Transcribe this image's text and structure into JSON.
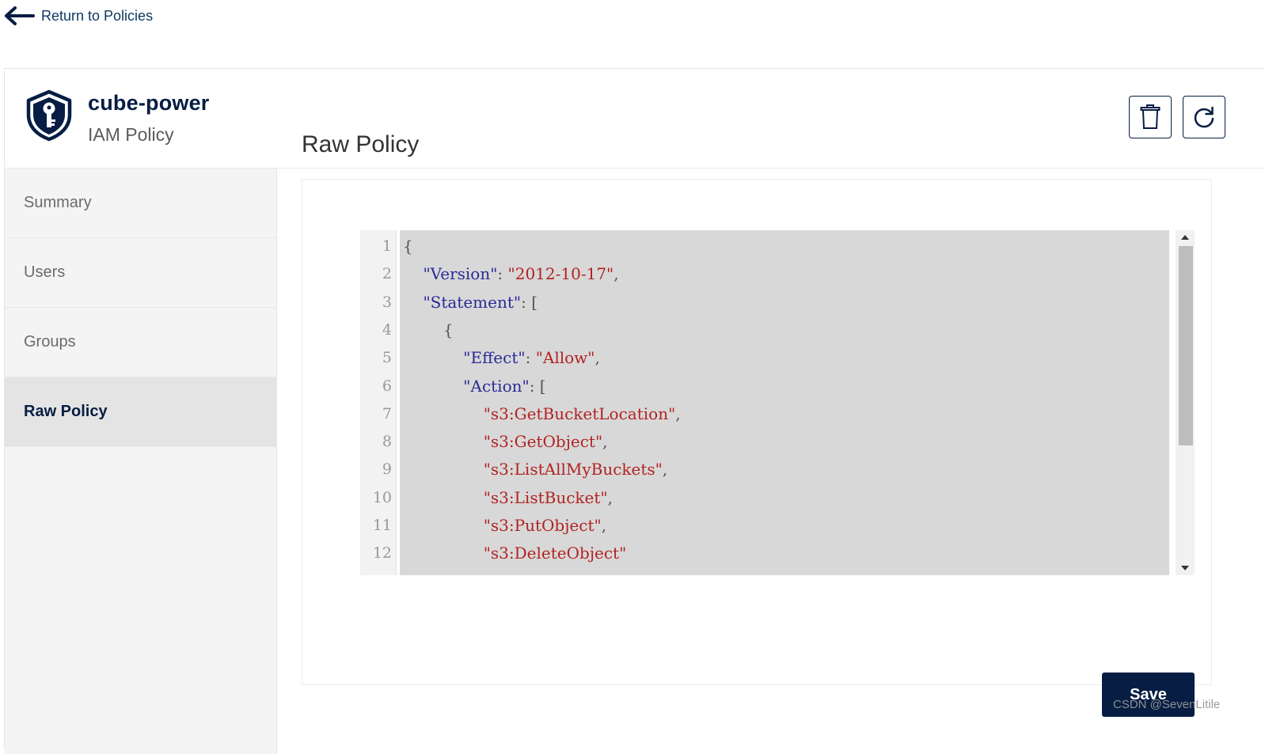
{
  "nav": {
    "back_label": "Return to Policies"
  },
  "policy": {
    "name": "cube-power",
    "type_label": "IAM Policy"
  },
  "sidebar": {
    "items": [
      {
        "label": "Summary",
        "active": false
      },
      {
        "label": "Users",
        "active": false
      },
      {
        "label": "Groups",
        "active": false
      },
      {
        "label": "Raw Policy",
        "active": true
      }
    ]
  },
  "main": {
    "title": "Raw Policy",
    "save_label": "Save"
  },
  "editor": {
    "lines": [
      {
        "n": "1",
        "segs": [
          {
            "t": "{",
            "c": "pun"
          }
        ]
      },
      {
        "n": "2",
        "segs": [
          {
            "t": "    ",
            "c": "pun"
          },
          {
            "t": "\"Version\"",
            "c": "key"
          },
          {
            "t": ": ",
            "c": "pun"
          },
          {
            "t": "\"2012-10-17\"",
            "c": "str"
          },
          {
            "t": ",",
            "c": "pun"
          }
        ]
      },
      {
        "n": "3",
        "segs": [
          {
            "t": "    ",
            "c": "pun"
          },
          {
            "t": "\"Statement\"",
            "c": "key"
          },
          {
            "t": ": [",
            "c": "pun"
          }
        ]
      },
      {
        "n": "4",
        "segs": [
          {
            "t": "        {",
            "c": "pun"
          }
        ]
      },
      {
        "n": "5",
        "segs": [
          {
            "t": "            ",
            "c": "pun"
          },
          {
            "t": "\"Effect\"",
            "c": "key"
          },
          {
            "t": ": ",
            "c": "pun"
          },
          {
            "t": "\"Allow\"",
            "c": "str"
          },
          {
            "t": ",",
            "c": "pun"
          }
        ]
      },
      {
        "n": "6",
        "segs": [
          {
            "t": "            ",
            "c": "pun"
          },
          {
            "t": "\"Action\"",
            "c": "key"
          },
          {
            "t": ": [",
            "c": "pun"
          }
        ]
      },
      {
        "n": "7",
        "segs": [
          {
            "t": "                ",
            "c": "pun"
          },
          {
            "t": "\"s3:GetBucketLocation\"",
            "c": "str"
          },
          {
            "t": ",",
            "c": "pun"
          }
        ]
      },
      {
        "n": "8",
        "segs": [
          {
            "t": "                ",
            "c": "pun"
          },
          {
            "t": "\"s3:GetObject\"",
            "c": "str"
          },
          {
            "t": ",",
            "c": "pun"
          }
        ]
      },
      {
        "n": "9",
        "segs": [
          {
            "t": "                ",
            "c": "pun"
          },
          {
            "t": "\"s3:ListAllMyBuckets\"",
            "c": "str"
          },
          {
            "t": ",",
            "c": "pun"
          }
        ]
      },
      {
        "n": "10",
        "segs": [
          {
            "t": "                ",
            "c": "pun"
          },
          {
            "t": "\"s3:ListBucket\"",
            "c": "str"
          },
          {
            "t": ",",
            "c": "pun"
          }
        ]
      },
      {
        "n": "11",
        "segs": [
          {
            "t": "                ",
            "c": "pun"
          },
          {
            "t": "\"s3:PutObject\"",
            "c": "str"
          },
          {
            "t": ",",
            "c": "pun"
          }
        ]
      },
      {
        "n": "12",
        "segs": [
          {
            "t": "                ",
            "c": "pun"
          },
          {
            "t": "\"s3:DeleteObject\"",
            "c": "str"
          }
        ]
      }
    ]
  },
  "watermark": "CSDN @SevenLitile"
}
